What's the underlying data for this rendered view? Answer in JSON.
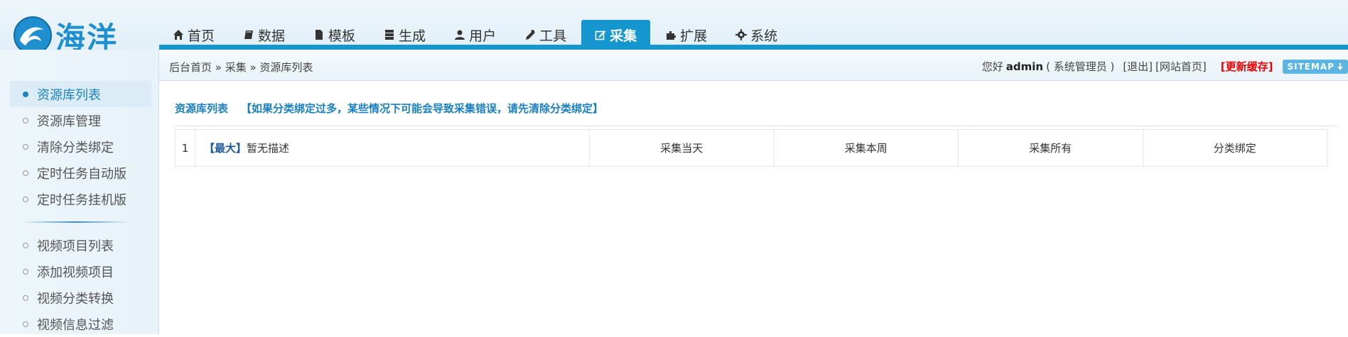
{
  "logo": {
    "text": "海洋"
  },
  "nav": [
    {
      "label": "首页",
      "icon": "home-icon"
    },
    {
      "label": "数据",
      "icon": "book-icon"
    },
    {
      "label": "模板",
      "icon": "file-icon"
    },
    {
      "label": "生成",
      "icon": "server-icon"
    },
    {
      "label": "用户",
      "icon": "user-icon"
    },
    {
      "label": "工具",
      "icon": "wrench-icon"
    },
    {
      "label": "采集",
      "icon": "edit-icon",
      "active": true
    },
    {
      "label": "扩展",
      "icon": "puzzle-icon"
    },
    {
      "label": "系统",
      "icon": "gear-icon"
    }
  ],
  "breadcrumb": {
    "text": "后台首页 » 采集 » 资源库列表"
  },
  "user": {
    "greeting": "您好",
    "name": "admin",
    "role": "( 系统管理员 )",
    "logout": "[退出]",
    "site_home": "[网站首页]",
    "refresh_cache": "[更新缓存]",
    "sitemap": "SITEMAP"
  },
  "sidebar": {
    "group1": [
      "资源库列表",
      "资源库管理",
      "清除分类绑定",
      "定时任务自动版",
      "定时任务挂机版"
    ],
    "group2": [
      "视频项目列表",
      "添加视频项目",
      "视频分类转换",
      "视频信息过滤"
    ],
    "active": "资源库列表"
  },
  "main": {
    "title": "资源库列表",
    "warning": "【如果分类绑定过多，某些情况下可能会导致采集错误，请先清除分类绑定】",
    "rows": [
      {
        "num": "1",
        "tag": "【最大】",
        "desc": "暂无描述",
        "actions": [
          "采集当天",
          "采集本周",
          "采集所有",
          "分类绑定"
        ]
      }
    ]
  },
  "colors": {
    "accent": "#1596cf",
    "warning_text": "#1a7fc0",
    "refresh": "#ee0000"
  }
}
